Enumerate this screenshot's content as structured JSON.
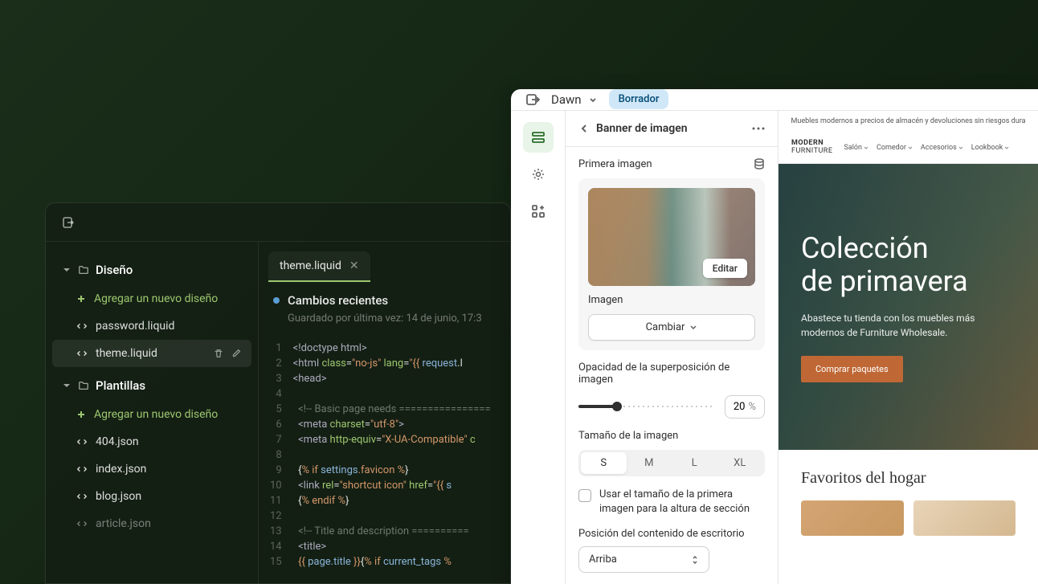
{
  "editor": {
    "sections": {
      "design": "Diseño",
      "templates": "Plantillas"
    },
    "add_new": "Agregar un nuevo diseño",
    "files": {
      "password": "password.liquid",
      "theme": "theme.liquid",
      "json404": "404.json",
      "index": "index.json",
      "blog": "blog.json",
      "article": "article.json"
    },
    "tab": "theme.liquid",
    "recent_title": "Cambios recientes",
    "recent_saved": "Guardado por última vez: 14 de junio, 17:3",
    "code": {
      "l1": "<!doctype html>",
      "l2a": "<html ",
      "l2b": "class",
      "l2c": "=",
      "l2d": "\"no-js\"",
      "l2e": " lang",
      "l2f": "=",
      "l2g": "\"",
      "l2h": "{{ ",
      "l2i": "request",
      "l2j": ".l",
      "l3": "<head>",
      "l5": "<!-- Basic page needs ================",
      "l6a": "<meta ",
      "l6b": "charset",
      "l6c": "=",
      "l6d": "\"utf-8\"",
      "l6e": ">",
      "l7a": "<meta ",
      "l7b": "http-equiv",
      "l7c": "=",
      "l7d": "\"X-UA-Compatible\"",
      "l7e": " c",
      "l9a": "{",
      "l9b": "% if ",
      "l9c": "settings",
      "l9d": ".favicon %",
      "l9e": "}",
      "l10a": "<link ",
      "l10b": "rel",
      "l10c": "=",
      "l10d": "\"shortcut icon\"",
      "l10e": " href",
      "l10f": "=",
      "l10g": "\"",
      "l10h": "{{ ",
      "l10i": "s",
      "l11a": "{",
      "l11b": "% endif %",
      "l11c": "}",
      "l13": "<!-- Title and description ==========",
      "l14": "<title>",
      "l15a": "{{ ",
      "l15b": "page.title ",
      "l15c": "}}",
      "l15d": "{",
      "l15e": "% if ",
      "l15f": "current_tags ",
      "l15g": "%"
    }
  },
  "customizer": {
    "theme_name": "Dawn",
    "draft_badge": "Borrador",
    "section_title": "Banner de imagen",
    "first_image": "Primera imagen",
    "edit": "Editar",
    "image_label": "Imagen",
    "change": "Cambiar",
    "opacity_label": "Opacidad de la superposición de imagen",
    "opacity_value": "20",
    "opacity_unit": "%",
    "size_label": "Tamaño de la imagen",
    "sizes": {
      "s": "S",
      "m": "M",
      "l": "L",
      "xl": "XL"
    },
    "checkbox_label": "Usar el tamaño de la primera imagen para la altura de sección",
    "position_label": "Posición del contenido de escritorio",
    "position_value": "Arriba"
  },
  "preview": {
    "announcement": "Muebles modernos a precios de almacén y devoluciones sin riesgos dura",
    "logo_line1": "MODERN",
    "logo_line2": "FURNITURE",
    "nav": {
      "salon": "Salón",
      "comedor": "Comedor",
      "accesorios": "Accesorios",
      "lookbook": "Lookbook"
    },
    "hero_title_l1": "Colección",
    "hero_title_l2": "de primavera",
    "hero_sub": "Abastece tu tienda con los muebles más modernos de Furniture Wholesale.",
    "hero_cta": "Comprar paquetes",
    "favorites_title": "Favoritos del hogar"
  }
}
